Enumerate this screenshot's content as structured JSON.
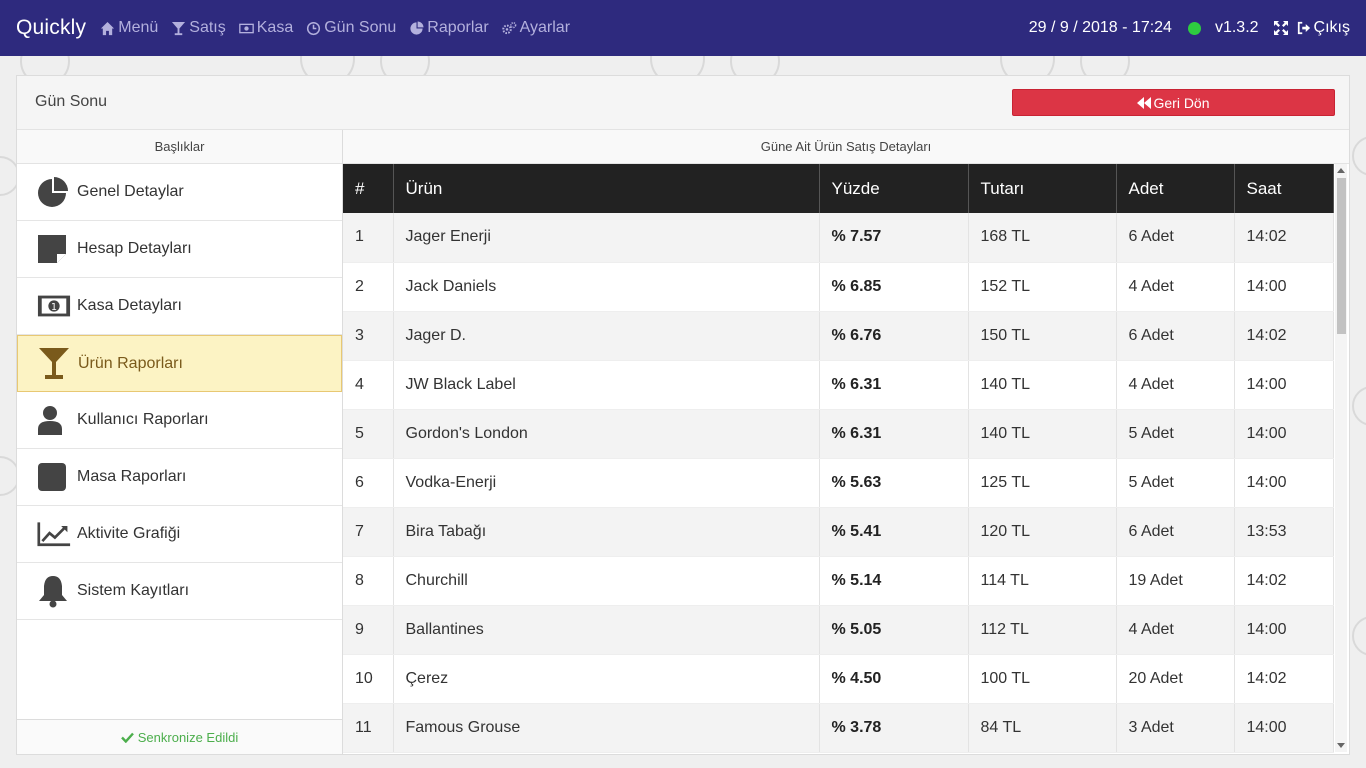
{
  "app": {
    "brand": "Quickly"
  },
  "nav": {
    "items": [
      {
        "label": "Menü",
        "icon": "home-icon"
      },
      {
        "label": "Satış",
        "icon": "glass-icon"
      },
      {
        "label": "Kasa",
        "icon": "money-icon"
      },
      {
        "label": "Gün Sonu",
        "icon": "clock-icon"
      },
      {
        "label": "Raporlar",
        "icon": "pie-chart-icon"
      },
      {
        "label": "Ayarlar",
        "icon": "gears-icon"
      }
    ],
    "datetime": "29 / 9 / 2018 - 17:24",
    "status_color": "#2ecc40",
    "version": "v1.3.2",
    "logout_label": "Çıkış"
  },
  "page": {
    "title": "Gün Sonu",
    "back_label": "Geri Dön"
  },
  "sidebar": {
    "header": "Başlıklar",
    "items": [
      {
        "label": "Genel Detaylar",
        "icon": "pie-chart-icon"
      },
      {
        "label": "Hesap Detayları",
        "icon": "sticky-note-icon"
      },
      {
        "label": "Kasa Detayları",
        "icon": "money-bill-icon"
      },
      {
        "label": "Ürün Raporları",
        "icon": "glass-icon",
        "active": true
      },
      {
        "label": "Kullanıcı Raporları",
        "icon": "user-icon"
      },
      {
        "label": "Masa Raporları",
        "icon": "square-icon"
      },
      {
        "label": "Aktivite Grafiği",
        "icon": "line-chart-icon"
      },
      {
        "label": "Sistem Kayıtları",
        "icon": "bell-icon"
      }
    ],
    "footer": "Senkronize Edildi"
  },
  "content": {
    "header": "Güne Ait Ürün Satış Detayları",
    "columns": [
      "#",
      "Ürün",
      "Yüzde",
      "Tutarı",
      "Adet",
      "Saat"
    ],
    "rows": [
      [
        "1",
        "Jager Enerji",
        "% 7.57",
        "168 TL",
        "6 Adet",
        "14:02"
      ],
      [
        "2",
        "Jack Daniels",
        "% 6.85",
        "152 TL",
        "4 Adet",
        "14:00"
      ],
      [
        "3",
        "Jager D.",
        "% 6.76",
        "150 TL",
        "6 Adet",
        "14:02"
      ],
      [
        "4",
        "JW Black Label",
        "% 6.31",
        "140 TL",
        "4 Adet",
        "14:00"
      ],
      [
        "5",
        "Gordon's London",
        "% 6.31",
        "140 TL",
        "5 Adet",
        "14:00"
      ],
      [
        "6",
        "Vodka-Enerji",
        "% 5.63",
        "125 TL",
        "5 Adet",
        "14:00"
      ],
      [
        "7",
        "Bira Tabağı",
        "% 5.41",
        "120 TL",
        "6 Adet",
        "13:53"
      ],
      [
        "8",
        "Churchill",
        "% 5.14",
        "114 TL",
        "19 Adet",
        "14:02"
      ],
      [
        "9",
        "Ballantines",
        "% 5.05",
        "112 TL",
        "4 Adet",
        "14:00"
      ],
      [
        "10",
        "Çerez",
        "% 4.50",
        "100 TL",
        "20 Adet",
        "14:02"
      ],
      [
        "11",
        "Famous Grouse",
        "% 3.78",
        "84 TL",
        "3 Adet",
        "14:00"
      ]
    ]
  },
  "colors": {
    "navbar": "#2e2a7e",
    "danger": "#dc3545",
    "active_bg": "#fcf3c4",
    "success": "#4cae4c"
  }
}
